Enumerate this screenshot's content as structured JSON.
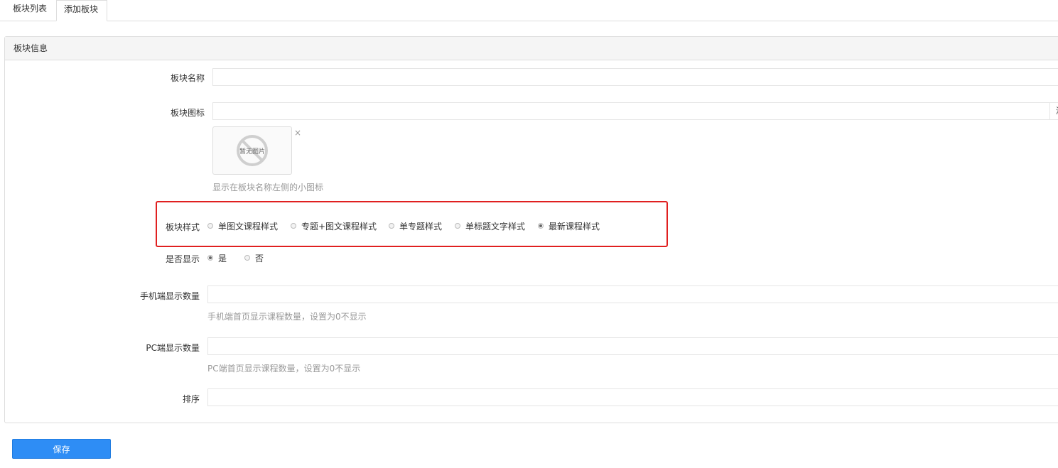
{
  "tabs": [
    {
      "label": "板块列表"
    },
    {
      "label": "添加板块"
    }
  ],
  "panel": {
    "title": "板块信息"
  },
  "form": {
    "name": {
      "label": "板块名称",
      "value": ""
    },
    "icon": {
      "label": "板块图标",
      "value": "",
      "side_button": "浏",
      "placeholder_image_text": "暂无图片",
      "remove": "×",
      "help": "显示在板块名称左侧的小图标"
    },
    "style": {
      "label": "板块样式",
      "options": [
        {
          "label": "单图文课程样式",
          "checked": false
        },
        {
          "label": "专题+图文课程样式",
          "checked": false
        },
        {
          "label": "单专题样式",
          "checked": false
        },
        {
          "label": "单标题文字样式",
          "checked": false
        },
        {
          "label": "最新课程样式",
          "checked": true
        }
      ]
    },
    "display": {
      "label": "是否显示",
      "options": [
        {
          "label": "是",
          "checked": true
        },
        {
          "label": "否",
          "checked": false
        }
      ]
    },
    "mobile_count": {
      "label": "手机端显示数量",
      "value": "",
      "help": "手机端首页显示课程数量，设置为0不显示"
    },
    "pc_count": {
      "label": "PC端显示数量",
      "value": "",
      "help": "PC端首页显示课程数量，设置为0不显示"
    },
    "sort": {
      "label": "排序",
      "value": ""
    }
  },
  "save_label": "保存",
  "colors": {
    "primary": "#2e8df5",
    "highlight": "#e02020",
    "muted": "#999999"
  }
}
